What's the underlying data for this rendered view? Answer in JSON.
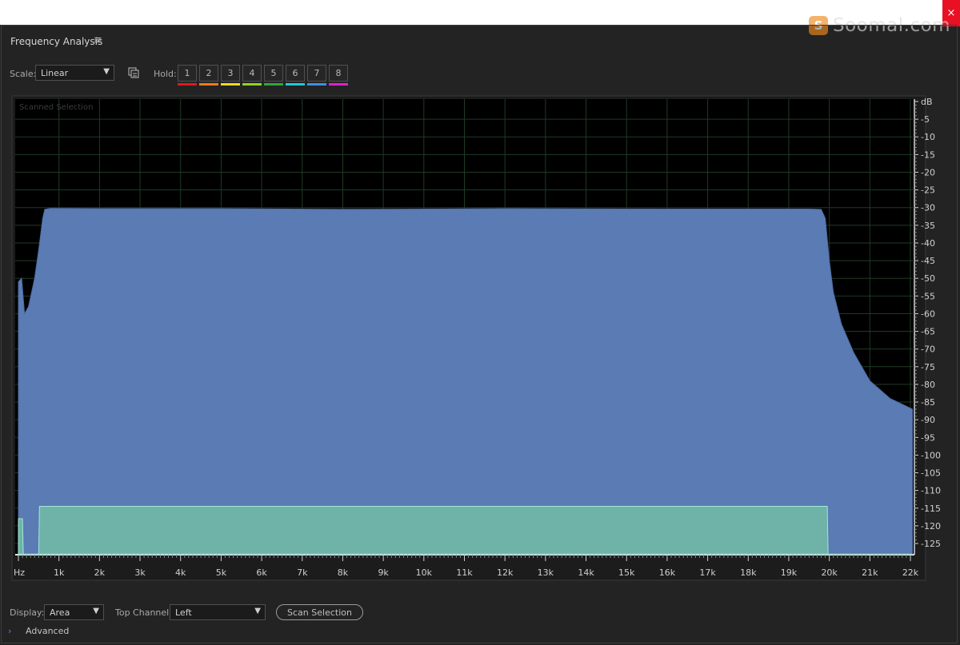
{
  "window": {
    "close_glyph": "×"
  },
  "watermark": {
    "logo_letter": "S",
    "text": "Soomal.com"
  },
  "panel": {
    "title": "Frequency Analysis",
    "menu_glyph": "≡"
  },
  "controls": {
    "scale_label": "Scale:",
    "scale_value": "Linear",
    "copy_icon": "copy-to-clipboard-icon",
    "hold_label": "Hold:",
    "hold_buttons": [
      "1",
      "2",
      "3",
      "4",
      "5",
      "6",
      "7",
      "8"
    ],
    "hold_colors": [
      "#e0191c",
      "#f07a1a",
      "#e8dd1c",
      "#8ed223",
      "#2fa63a",
      "#20c8d8",
      "#3f8fe0",
      "#e020d0"
    ]
  },
  "graph": {
    "overlay_label": "Scanned Selection",
    "colors": {
      "area": "#5b7bb4",
      "area_bottom": "#6fb3a8",
      "grid": "#1f3a26"
    }
  },
  "chart_data": {
    "type": "area",
    "xlabel": "Hz",
    "x_ticks": [
      "Hz",
      "1k",
      "2k",
      "3k",
      "4k",
      "5k",
      "6k",
      "7k",
      "8k",
      "9k",
      "10k",
      "11k",
      "12k",
      "13k",
      "14k",
      "15k",
      "16k",
      "17k",
      "18k",
      "19k",
      "20k",
      "21k",
      "22k"
    ],
    "ylabel": "dB",
    "y_ticks": [
      "dB",
      "-5",
      "-10",
      "-15",
      "-20",
      "-25",
      "-30",
      "-35",
      "-40",
      "-45",
      "-50",
      "-55",
      "-60",
      "-65",
      "-70",
      "-75",
      "-80",
      "-85",
      "-90",
      "-95",
      "-100",
      "-105",
      "-110",
      "-115",
      "-120",
      "-125"
    ],
    "xlim": [
      0,
      22050
    ],
    "ylim": [
      -128,
      0
    ],
    "grid": true,
    "series": [
      {
        "values": [
          [
            0,
            -51
          ],
          [
            80,
            -50
          ],
          [
            150,
            -60
          ],
          [
            250,
            -58
          ],
          [
            400,
            -50
          ],
          [
            500,
            -42
          ],
          [
            600,
            -33
          ],
          [
            650,
            -30.5
          ],
          [
            800,
            -30.2
          ],
          [
            2000,
            -30.3
          ],
          [
            5000,
            -30.3
          ],
          [
            8000,
            -30.5
          ],
          [
            12000,
            -30.3
          ],
          [
            16000,
            -30.4
          ],
          [
            19500,
            -30.4
          ],
          [
            19800,
            -30.5
          ],
          [
            19900,
            -33
          ],
          [
            20000,
            -45
          ],
          [
            20100,
            -54
          ],
          [
            20300,
            -63
          ],
          [
            20600,
            -71
          ],
          [
            21000,
            -79
          ],
          [
            21500,
            -84
          ],
          [
            22050,
            -87
          ]
        ]
      },
      {
        "values": [
          [
            0,
            -118
          ],
          [
            100,
            -118
          ],
          [
            120,
            -128
          ],
          [
            500,
            -128
          ],
          [
            520,
            -114.5
          ],
          [
            19950,
            -114.5
          ],
          [
            19970,
            -128
          ],
          [
            22050,
            -128
          ]
        ]
      }
    ]
  },
  "bottom": {
    "display_label": "Display:",
    "display_value": "Area",
    "top_channel_label": "Top Channel:",
    "top_channel_value": "Left",
    "scan_button_label": "Scan Selection",
    "advanced_label": "Advanced",
    "advanced_glyph": "›"
  }
}
